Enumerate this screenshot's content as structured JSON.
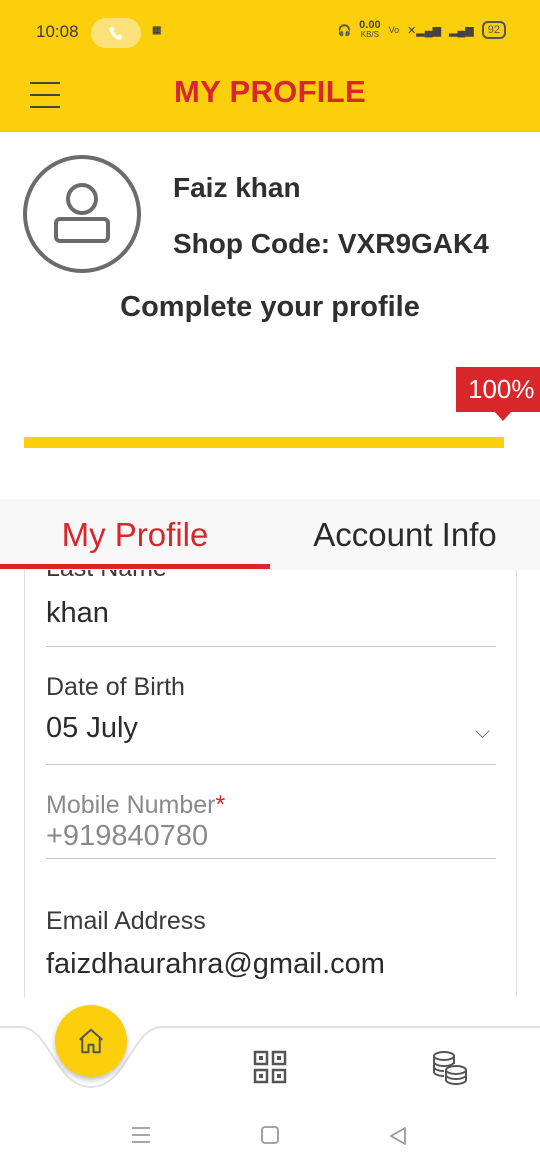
{
  "status_bar": {
    "time": "10:08",
    "net_speed_value": "0.00",
    "net_speed_unit": "KB/S",
    "battery": "92"
  },
  "header": {
    "title": "MY PROFILE"
  },
  "profile": {
    "name": "Faiz khan",
    "shop_code": "Shop Code: VXR9GAK4",
    "complete_title": "Complete your profile",
    "completion_percent": 100,
    "completion_label": "100%"
  },
  "tabs": [
    {
      "label": "My Profile",
      "active": true
    },
    {
      "label": "Account Info",
      "active": false
    }
  ],
  "form": {
    "last_name": {
      "label": "Last Name",
      "value": "khan"
    },
    "dob": {
      "label": "Date of Birth",
      "value": "05 July"
    },
    "mobile": {
      "label": "Mobile Number",
      "required_mark": "*",
      "value": "+919840780"
    },
    "email": {
      "label": "Email Address",
      "value": "faizdhaurahra@gmail.com"
    }
  },
  "bottom_nav": {
    "items": [
      "home-icon",
      "qr-code-icon",
      "coins-icon"
    ]
  },
  "colors": {
    "brand_yellow": "#fbcf0c",
    "brand_red": "#d8262b"
  }
}
